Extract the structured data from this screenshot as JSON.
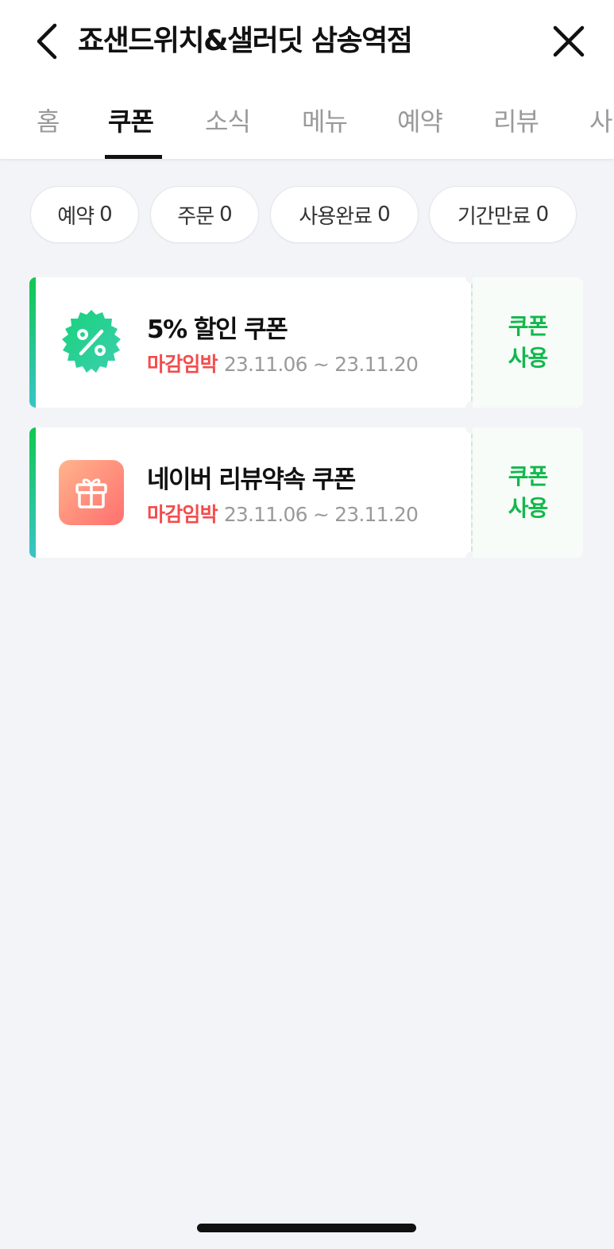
{
  "header": {
    "title": "죠샌드위치&샐러딧 삼송역점",
    "back_icon": "chevron-left-icon",
    "close_icon": "close-icon"
  },
  "tabs": [
    {
      "label": "홈",
      "active": false
    },
    {
      "label": "쿠폰",
      "active": true
    },
    {
      "label": "소식",
      "active": false
    },
    {
      "label": "메뉴",
      "active": false
    },
    {
      "label": "예약",
      "active": false
    },
    {
      "label": "리뷰",
      "active": false
    },
    {
      "label": "사",
      "active": false
    }
  ],
  "filters": [
    {
      "label": "예약",
      "count": "0"
    },
    {
      "label": "주문",
      "count": "0"
    },
    {
      "label": "사용완료",
      "count": "0"
    },
    {
      "label": "기간만료",
      "count": "0"
    }
  ],
  "coupons": [
    {
      "name": "5% 할인 쿠폰",
      "deadline_label": "마감임박",
      "period": "23.11.06 ~ 23.11.20",
      "action": "쿠폰 사용",
      "icon": "percent-badge-icon"
    },
    {
      "name": "네이버 리뷰약속 쿠폰",
      "deadline_label": "마감임박",
      "period": "23.11.06 ~ 23.11.20",
      "action": "쿠폰 사용",
      "icon": "gift-icon"
    }
  ],
  "colors": {
    "accent_green": "#12b84c",
    "deadline_red": "#f24d4d",
    "background": "#f2f4f7"
  }
}
